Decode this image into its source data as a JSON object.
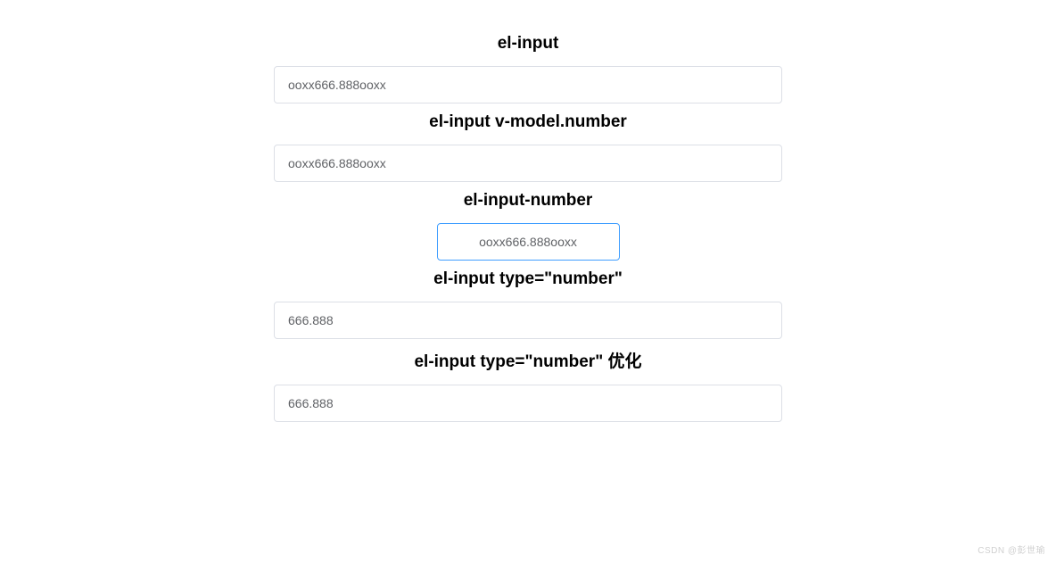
{
  "sections": [
    {
      "heading": "el-input",
      "value": "ooxx666.888ooxx",
      "type": "text"
    },
    {
      "heading": "el-input v-model.number",
      "value": "ooxx666.888ooxx",
      "type": "text"
    },
    {
      "heading": "el-input-number",
      "value": "ooxx666.888ooxx",
      "type": "number-styled"
    },
    {
      "heading": "el-input type=\"number\"",
      "value": "666.888",
      "type": "text"
    },
    {
      "heading": "el-input type=\"number\" 优化",
      "value": "666.888",
      "type": "text"
    }
  ],
  "watermark": "CSDN @彭世瑜"
}
